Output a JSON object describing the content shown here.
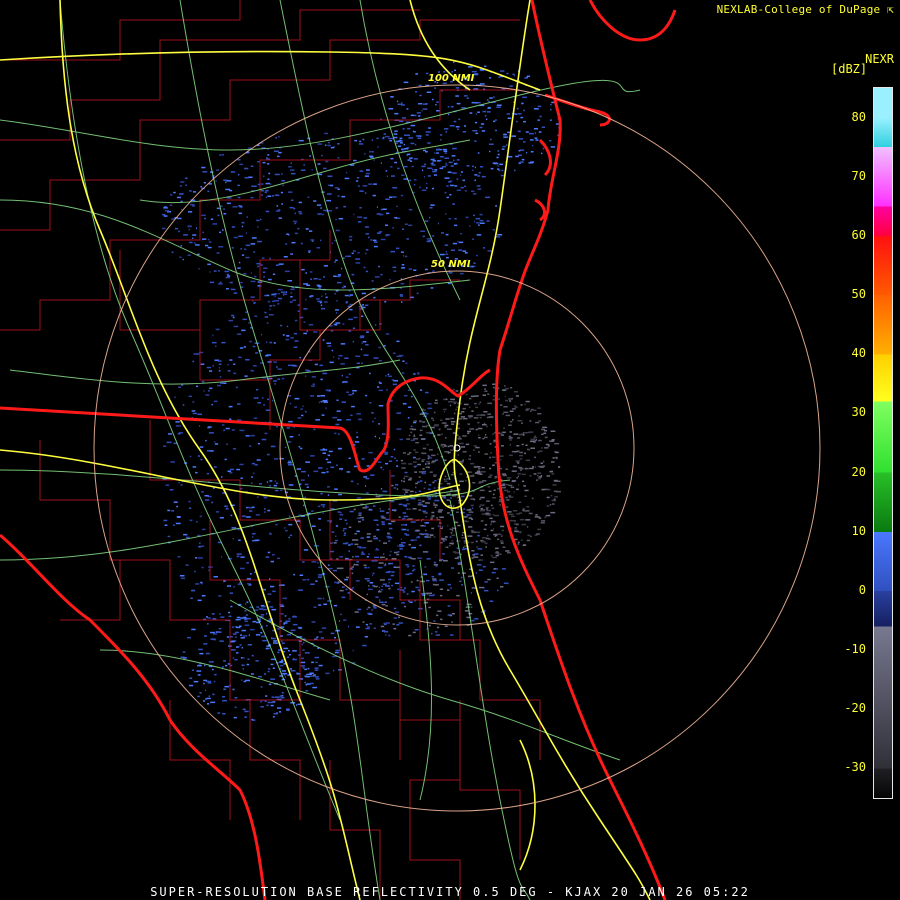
{
  "credit": "NEXLAB-College of DuPage",
  "credit_icon": "corner-arrow-icon",
  "product_code": "NEXR",
  "unit": "[dBZ]",
  "footer": "SUPER-RESOLUTION BASE REFLECTIVITY 0.5 DEG - KJAX 20 JAN 26 05:22",
  "range_rings": [
    {
      "label": "50 NMI"
    },
    {
      "label": "100 NMI"
    }
  ],
  "legend": {
    "ticks": [
      "80",
      "70",
      "60",
      "50",
      "40",
      "30",
      "20",
      "10",
      "0",
      "-10",
      "-20",
      "-30"
    ],
    "bands": [
      {
        "from": 80,
        "to": 75,
        "colors": [
          "#9af0ff",
          "#30d0e0"
        ]
      },
      {
        "from": 75,
        "to": 65,
        "colors": [
          "#f0c0ff",
          "#ff30ff"
        ]
      },
      {
        "from": 65,
        "to": 60,
        "colors": [
          "#ff00a0",
          "#ff0040"
        ]
      },
      {
        "from": 60,
        "to": 50,
        "colors": [
          "#ff1010",
          "#ff5a00"
        ]
      },
      {
        "from": 50,
        "to": 40,
        "colors": [
          "#ff6000",
          "#ffb000"
        ]
      },
      {
        "from": 40,
        "to": 32,
        "colors": [
          "#ffd000",
          "#ffff20"
        ]
      },
      {
        "from": 32,
        "to": 20,
        "colors": [
          "#80ff60",
          "#30e030"
        ]
      },
      {
        "from": 20,
        "to": 10,
        "colors": [
          "#28c028",
          "#0a7a10"
        ]
      },
      {
        "from": 10,
        "to": 0,
        "colors": [
          "#4a78ff",
          "#3050c0"
        ]
      },
      {
        "from": 0,
        "to": -6,
        "colors": [
          "#2a40a0",
          "#162060"
        ]
      },
      {
        "from": -6,
        "to": -30,
        "colors": [
          "#787890",
          "#303038"
        ]
      },
      {
        "from": -30,
        "to": -35,
        "colors": [
          "#202024",
          "#050505"
        ]
      }
    ]
  },
  "colors": {
    "state_border": "#ff1a1a",
    "county_line": "#c0141e",
    "highway": "#ffff40",
    "road": "#90e890",
    "range_ring": "#ffc0a0",
    "label": "#ffff33"
  }
}
